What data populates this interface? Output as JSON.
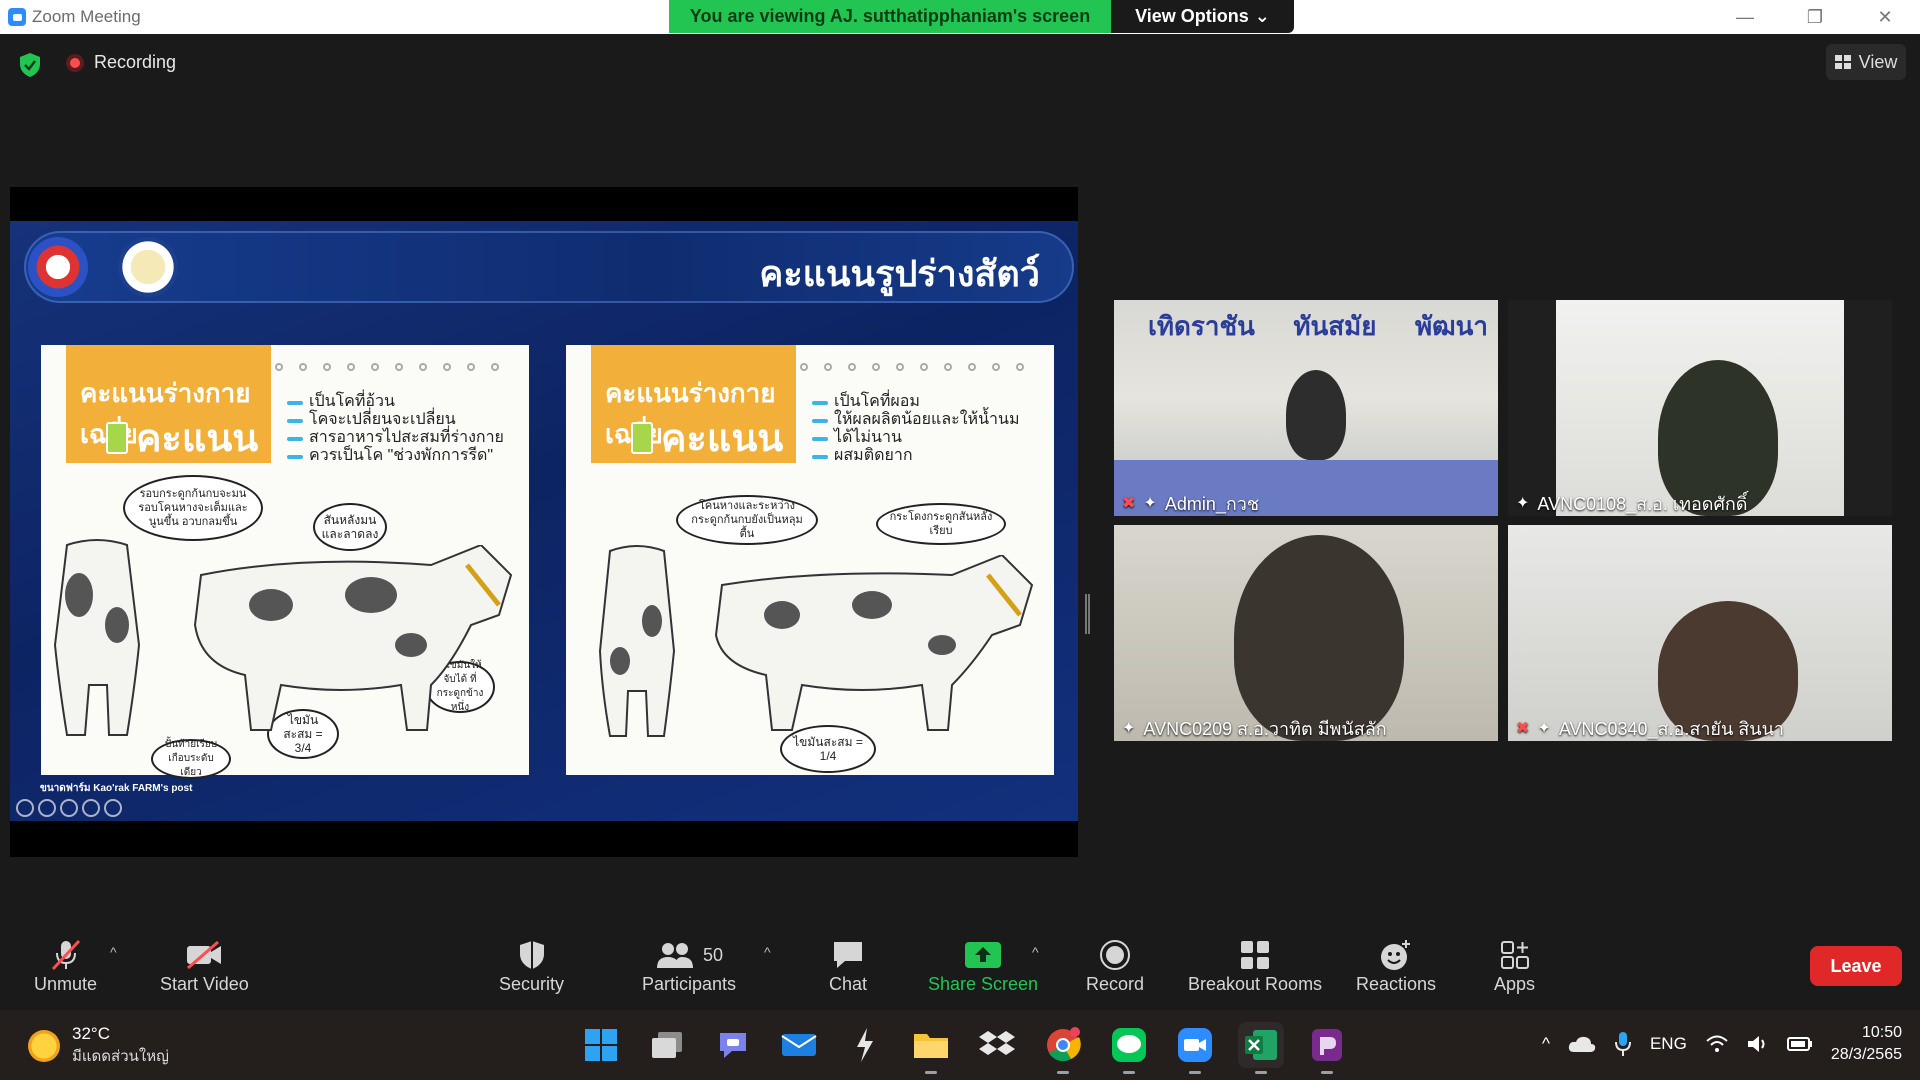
{
  "window": {
    "app_title": "Zoom Meeting",
    "viewing_banner": "You are viewing AJ. sutthatipphaniam's screen",
    "view_options": "View Options",
    "view_options_chevron": "⌄",
    "controls": {
      "minimize": "—",
      "restore": "❐",
      "close": "✕"
    }
  },
  "topbar": {
    "recording_label": "Recording",
    "view_label": "View"
  },
  "slide": {
    "title": "คะแนนรูปร่างสัตว์",
    "panel1": {
      "label": "คะแนนร่างกายเฉลี่ย",
      "score_word": "คะแนน",
      "bullets": [
        "เป็นโคที่อ้วน",
        "โคจะเปลี่ยนจะเปลี่ยน",
        "สารอาหารไปสะสมที่ร่างกาย",
        "ควรเป็นโค \"ช่วงพักการรีด\""
      ],
      "bubbles": [
        "รอบกระดูกก้นกบจะมน รอบโคนหางจะเต็มและนูนขึ้น อวบกลมขึ้น",
        "สันหลังมน และลาดลง",
        "มีไขมันให้จับได้ ที่กระดูกข้างหนึ่ง",
        "ไขมันสะสม = 3/4",
        "ปั้นท้ายเรียบ เกือบระดับเดียว"
      ]
    },
    "panel2": {
      "label": "คะแนนร่างกายเฉลี่ย",
      "score_word": "คะแนน",
      "bullets": [
        "เป็นโคที่ผอม",
        "ให้ผลผลิตน้อยและให้น้ำนม",
        "ได้ไม่นาน",
        "ผสมติดยาก"
      ],
      "bubbles": [
        "โคนหางและระหว่าง กระดูกก้นกบยังเป็นหลุมตื้น",
        "กระโดงกระดูกสันหลังเรียบ",
        "ไขมันสะสม = 1/4"
      ]
    },
    "footer": "ขนาดฟาร์ม Kao'rak FARM's post"
  },
  "participants_grid": [
    {
      "name": "Admin_กวช",
      "muted": true,
      "banner": [
        "เทิดราชัน",
        "ทันสมัย",
        "พัฒนา"
      ]
    },
    {
      "name": "AVNC0108_ส.อ. เทอดศักดิ์",
      "muted": false
    },
    {
      "name": "AVNC0209 ส.อ.วาทิต มีพนัสลัก",
      "muted": false
    },
    {
      "name": "AVNC0340_ส.อ.สายัน สินนา",
      "muted": true
    }
  ],
  "toolbar": {
    "unmute": "Unmute",
    "start_video": "Start Video",
    "security": "Security",
    "participants": "Participants",
    "participants_count": "50",
    "chat": "Chat",
    "share_screen": "Share Screen",
    "record": "Record",
    "breakout_rooms": "Breakout Rooms",
    "reactions": "Reactions",
    "apps": "Apps",
    "leave": "Leave",
    "caret": "^"
  },
  "taskbar": {
    "weather_temp": "32°C",
    "weather_desc": "มีแดดส่วนใหญ่",
    "language": "ENG",
    "time": "10:50",
    "date": "28/3/2565",
    "tray_chevron": "^"
  },
  "colors": {
    "accent_green": "#23c552",
    "leave_red": "#e02828",
    "dark_bg": "#1a1a1a"
  }
}
